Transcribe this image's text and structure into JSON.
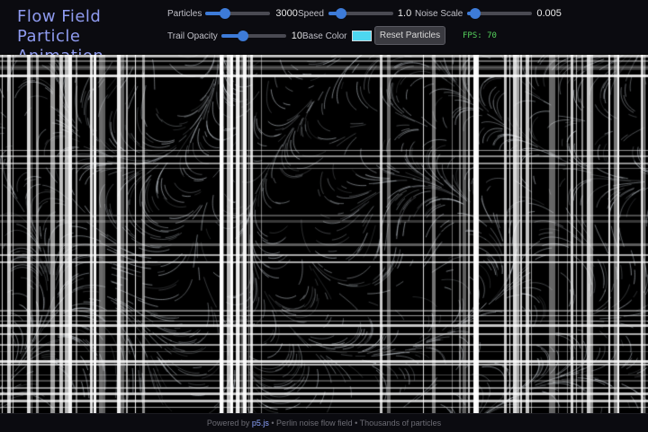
{
  "app": {
    "title": "Flow Field Particle Animation"
  },
  "controls": {
    "particles": {
      "label": "Particles",
      "value": "3000",
      "level": 0.3
    },
    "speed": {
      "label": "Speed",
      "value": "1.0",
      "level": 0.2
    },
    "noise_scale": {
      "label": "Noise Scale",
      "value": "0.005",
      "level": 0.12
    },
    "trail_opacity": {
      "label": "Trail Opacity",
      "value": "10",
      "level": 0.33
    },
    "base_color": {
      "label": "Base Color",
      "color": "#4dd7f0"
    },
    "reset_label": "Reset Particles",
    "fps": "FPS: 70"
  },
  "colors": {
    "accent": "#3d7bd8",
    "title": "#8f9bf0",
    "fps": "#56d45d",
    "background": "#000000"
  },
  "footer": {
    "prefix": "Powered by ",
    "link": "p5.js",
    "suffix": " • Perlin noise flow field • Thousands of particles"
  }
}
